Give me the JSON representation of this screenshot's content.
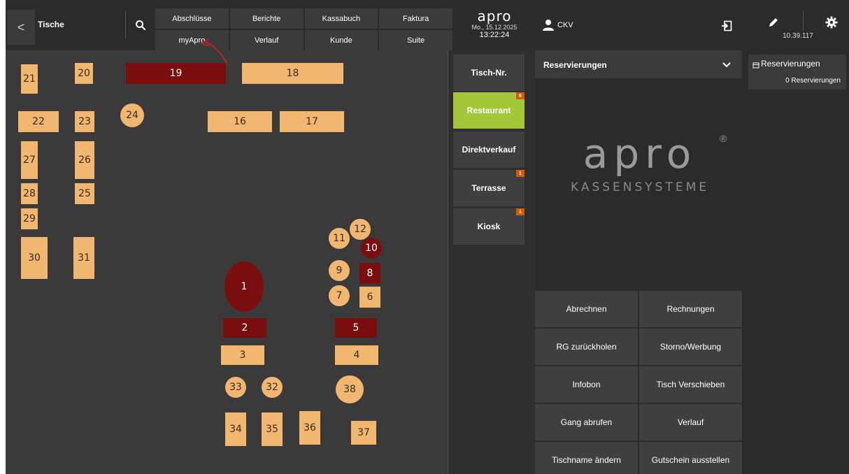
{
  "topbar": {
    "back_label": "<",
    "area_title": "Tische",
    "menu": [
      "Abschlüsse",
      "Berichte",
      "Kassabuch",
      "Faktura",
      "myApro",
      "Verlauf",
      "Kunde",
      "Suite"
    ],
    "logo_text": "apro",
    "date": "Mo., 15.12.2025",
    "time": "13:22:24",
    "user": "CKV",
    "ip": "10.39.117"
  },
  "tables": [
    {
      "label": "21",
      "status": "free",
      "shape": "rect"
    },
    {
      "label": "20",
      "status": "free",
      "shape": "rect"
    },
    {
      "label": "19",
      "status": "busy",
      "shape": "rect"
    },
    {
      "label": "18",
      "status": "free",
      "shape": "rect"
    },
    {
      "label": "22",
      "status": "free",
      "shape": "rect"
    },
    {
      "label": "23",
      "status": "free",
      "shape": "rect"
    },
    {
      "label": "24",
      "status": "free",
      "shape": "round"
    },
    {
      "label": "16",
      "status": "free",
      "shape": "rect"
    },
    {
      "label": "17",
      "status": "free",
      "shape": "rect"
    },
    {
      "label": "27",
      "status": "free",
      "shape": "rect"
    },
    {
      "label": "26",
      "status": "free",
      "shape": "rect"
    },
    {
      "label": "28",
      "status": "free",
      "shape": "rect"
    },
    {
      "label": "25",
      "status": "free",
      "shape": "rect"
    },
    {
      "label": "29",
      "status": "free",
      "shape": "rect"
    },
    {
      "label": "30",
      "status": "free",
      "shape": "rect"
    },
    {
      "label": "31",
      "status": "free",
      "shape": "rect"
    },
    {
      "label": "12",
      "status": "free",
      "shape": "round"
    },
    {
      "label": "11",
      "status": "free",
      "shape": "round"
    },
    {
      "label": "10",
      "status": "busy",
      "shape": "round"
    },
    {
      "label": "9",
      "status": "free",
      "shape": "round"
    },
    {
      "label": "8",
      "status": "busy",
      "shape": "rect"
    },
    {
      "label": "1",
      "status": "busy",
      "shape": "oval"
    },
    {
      "label": "7",
      "status": "free",
      "shape": "round"
    },
    {
      "label": "6",
      "status": "free",
      "shape": "rect"
    },
    {
      "label": "2",
      "status": "busy",
      "shape": "rect"
    },
    {
      "label": "5",
      "status": "busy",
      "shape": "rect"
    },
    {
      "label": "3",
      "status": "free",
      "shape": "rect"
    },
    {
      "label": "4",
      "status": "free",
      "shape": "rect"
    },
    {
      "label": "33",
      "status": "free",
      "shape": "round"
    },
    {
      "label": "32",
      "status": "free",
      "shape": "round"
    },
    {
      "label": "38",
      "status": "free",
      "shape": "round"
    },
    {
      "label": "34",
      "status": "free",
      "shape": "rect"
    },
    {
      "label": "35",
      "status": "free",
      "shape": "rect"
    },
    {
      "label": "36",
      "status": "free",
      "shape": "rect"
    },
    {
      "label": "37",
      "status": "free",
      "shape": "rect"
    }
  ],
  "areas": [
    {
      "label": "Tisch-Nr.",
      "badge": "",
      "active": false
    },
    {
      "label": "Restaurant",
      "badge": "6",
      "active": true
    },
    {
      "label": "Direktverkauf",
      "badge": "",
      "active": false
    },
    {
      "label": "Terrasse",
      "badge": "1",
      "active": false
    },
    {
      "label": "Kiosk",
      "badge": "1",
      "active": false
    }
  ],
  "panel": {
    "reservation_select": "Reservierungen",
    "logo_word": "apro",
    "logo_sub": "KASSENSYSTEME",
    "actions": [
      "Abrechnen",
      "Rechnungen",
      "RG zurückholen",
      "Storno/Werbung",
      "Infobon",
      "Tisch Verschieben",
      "Gang abrufen",
      "Verlauf",
      "Tischname ändern",
      "Gutschein ausstellen"
    ]
  },
  "reservations": {
    "title": "Reservierungen",
    "count_text": "0 Reservierungen"
  },
  "colors": {
    "free": "#f1b771",
    "busy": "#7a0d0d",
    "active_area": "#a4c639",
    "badge": "#d45a00",
    "annotation": "#d62020"
  }
}
